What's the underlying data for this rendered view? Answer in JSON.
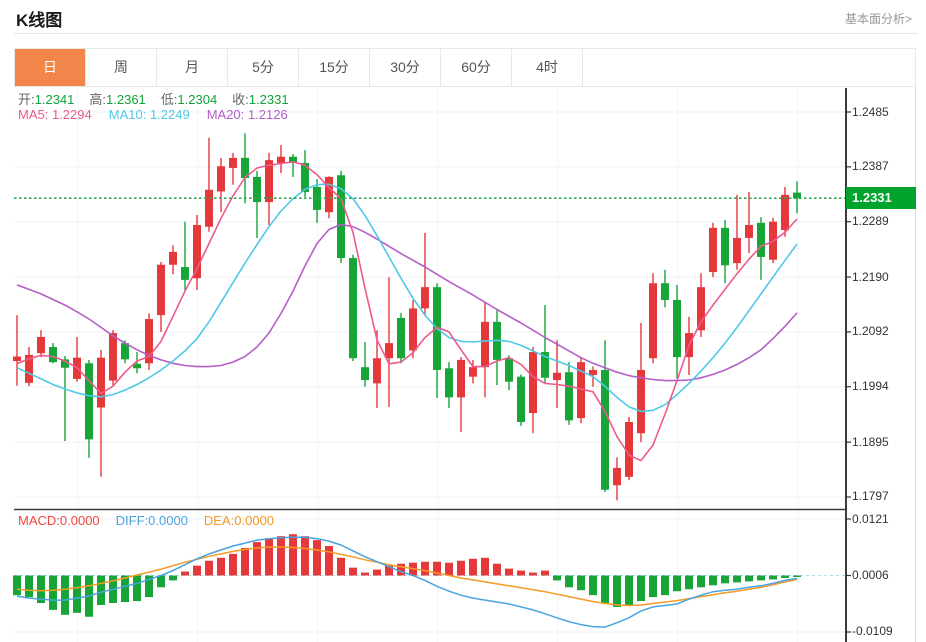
{
  "header": {
    "title": "K线图",
    "analysis_link": "基本面分析>"
  },
  "tabs": {
    "items": [
      {
        "name": "day",
        "label": "日",
        "active": true
      },
      {
        "name": "week",
        "label": "周",
        "active": false
      },
      {
        "name": "month",
        "label": "月",
        "active": false
      },
      {
        "name": "5min",
        "label": "5分",
        "active": false
      },
      {
        "name": "15min",
        "label": "15分",
        "active": false
      },
      {
        "name": "30min",
        "label": "30分",
        "active": false
      },
      {
        "name": "60min",
        "label": "60分",
        "active": false
      },
      {
        "name": "4hour",
        "label": "4时",
        "active": false
      }
    ]
  },
  "kline_legend": {
    "open_label": "开:",
    "open": "1.2341",
    "high_label": "高:",
    "high": "1.2361",
    "low_label": "低:",
    "low": "1.2304",
    "close_label": "收:",
    "close": "1.2331",
    "ma5_label": "MA5:",
    "ma5": "1.2294",
    "ma10_label": "MA10:",
    "ma10": "1.2249",
    "ma20_label": "MA20:",
    "ma20": "1.2126"
  },
  "macd_legend": {
    "macd_label": "MACD:",
    "macd": "0.0000",
    "diff_label": "DIFF:",
    "diff": "0.0000",
    "dea_label": "DEA:",
    "dea": "0.0000"
  },
  "price_axis": {
    "labels": [
      "1.2485",
      "1.2387",
      "1.2289",
      "1.2190",
      "1.2092",
      "1.1994",
      "1.1895",
      "1.1797"
    ],
    "current_price": "1.2331"
  },
  "macd_axis": {
    "labels": [
      "0.0121",
      "0.0006",
      "-0.0109"
    ]
  },
  "colors": {
    "accent_orange": "#f1854a",
    "up_red": "#e5383b",
    "down_green": "#17a538",
    "badge_green": "#00a32c",
    "price_line_green": "#2faa4e",
    "value_green": "#11a23a",
    "ma5_pink": "#ee5a8c",
    "ma10_cyan": "#4ec9e6",
    "ma20_purple": "#b55ec8",
    "macd_red": "#f0453c",
    "diff_blue": "#4aa3e0",
    "dea_orange": "#f59a23",
    "grid": "#edf1f7",
    "axis_dark": "#3a3a3a",
    "macd_zero_dash": "#b5d9e8"
  },
  "chart_data": {
    "type": "candlestick+macd",
    "title": "K线图 (日)",
    "y_range": [
      1.1797,
      1.2485
    ],
    "macd_y_range": [
      -0.0109,
      0.0121
    ],
    "grid": true,
    "candles_ohlc": [
      [
        1.204,
        1.2122,
        1.1996,
        1.2048
      ],
      [
        1.2001,
        1.2065,
        1.1995,
        1.2051
      ],
      [
        1.2054,
        1.2095,
        1.2047,
        1.2083
      ],
      [
        1.2065,
        1.2072,
        1.2036,
        1.2038
      ],
      [
        1.2043,
        1.2049,
        1.1897,
        1.2028
      ],
      [
        1.2008,
        1.2083,
        1.2003,
        1.2046
      ],
      [
        1.2036,
        1.2042,
        1.1867,
        1.19
      ],
      [
        1.1957,
        1.206,
        1.1833,
        1.2046
      ],
      [
        1.2005,
        1.2095,
        1.1997,
        1.209
      ],
      [
        1.2072,
        1.2077,
        1.2036,
        1.2043
      ],
      [
        1.2035,
        1.2056,
        1.2018,
        1.2027
      ],
      [
        1.2036,
        1.2125,
        1.2024,
        1.2115
      ],
      [
        1.2122,
        1.2217,
        1.2092,
        1.2212
      ],
      [
        1.2212,
        1.2247,
        1.2195,
        1.2235
      ],
      [
        1.2208,
        1.2289,
        1.2167,
        1.2185
      ],
      [
        1.2188,
        1.2301,
        1.2167,
        1.2283
      ],
      [
        1.228,
        1.2439,
        1.2271,
        1.2346
      ],
      [
        1.2343,
        1.2403,
        1.2306,
        1.2388
      ],
      [
        1.2385,
        1.2412,
        1.2355,
        1.2403
      ],
      [
        1.2403,
        1.2447,
        1.2322,
        1.2367
      ],
      [
        1.2369,
        1.238,
        1.226,
        1.2324
      ],
      [
        1.2324,
        1.2412,
        1.2283,
        1.2399
      ],
      [
        1.2394,
        1.2426,
        1.2376,
        1.2405
      ],
      [
        1.2405,
        1.241,
        1.2369,
        1.2394
      ],
      [
        1.2394,
        1.2417,
        1.2333,
        1.2342
      ],
      [
        1.2351,
        1.2365,
        1.2287,
        1.231
      ],
      [
        1.2306,
        1.237,
        1.2295,
        1.2369
      ],
      [
        1.2372,
        1.238,
        1.2215,
        1.2224
      ],
      [
        1.2224,
        1.223,
        1.204,
        1.2045
      ],
      [
        1.2029,
        1.2074,
        1.1994,
        1.2006
      ],
      [
        1.2,
        1.2095,
        1.1956,
        1.2045
      ],
      [
        1.2045,
        1.219,
        1.1958,
        1.2072
      ],
      [
        1.2117,
        1.2126,
        1.2036,
        1.2045
      ],
      [
        1.2059,
        1.2149,
        1.2045,
        1.2134
      ],
      [
        1.2134,
        1.2269,
        1.212,
        1.2172
      ],
      [
        1.2172,
        1.2179,
        1.1974,
        1.2024
      ],
      [
        1.2027,
        1.2038,
        1.1956,
        1.1975
      ],
      [
        1.1975,
        1.2047,
        1.1913,
        1.2042
      ],
      [
        1.2012,
        1.2042,
        1.2,
        1.2029
      ],
      [
        1.2029,
        1.2146,
        1.1975,
        1.211
      ],
      [
        1.211,
        1.2131,
        1.1997,
        1.2042
      ],
      [
        1.2045,
        1.205,
        1.1988,
        1.2003
      ],
      [
        1.2012,
        1.2016,
        1.1924,
        1.1931
      ],
      [
        1.1947,
        1.2065,
        1.1911,
        1.2056
      ],
      [
        1.2056,
        1.214,
        1.2,
        1.201
      ],
      [
        1.2006,
        1.2077,
        1.1956,
        1.2019
      ],
      [
        1.202,
        1.2038,
        1.1926,
        1.1934
      ],
      [
        1.1938,
        1.2047,
        1.1929,
        1.2038
      ],
      [
        1.2015,
        1.203,
        1.1994,
        1.2024
      ],
      [
        1.2024,
        1.2077,
        1.1806,
        1.181
      ],
      [
        1.1818,
        1.1868,
        1.1791,
        1.1849
      ],
      [
        1.1833,
        1.194,
        1.1827,
        1.1931
      ],
      [
        1.1911,
        1.2108,
        1.1895,
        1.2024
      ],
      [
        1.2045,
        1.2197,
        1.2036,
        1.2179
      ],
      [
        1.2179,
        1.2203,
        1.2136,
        1.2149
      ],
      [
        1.2149,
        1.2176,
        1.2009,
        1.2047
      ],
      [
        1.2047,
        1.2119,
        1.2015,
        1.209
      ],
      [
        1.2095,
        1.2197,
        1.2083,
        1.2172
      ],
      [
        1.2199,
        1.2287,
        1.219,
        1.2278
      ],
      [
        1.2278,
        1.2292,
        1.2179,
        1.2211
      ],
      [
        1.2215,
        1.2337,
        1.2203,
        1.226
      ],
      [
        1.226,
        1.2342,
        1.2233,
        1.2283
      ],
      [
        1.2287,
        1.2297,
        1.2185,
        1.2226
      ],
      [
        1.2221,
        1.2296,
        1.2215,
        1.2289
      ],
      [
        1.2274,
        1.2351,
        1.2262,
        1.2337
      ],
      [
        1.2341,
        1.2361,
        1.2304,
        1.2331
      ]
    ],
    "ma5": [
      1.2035,
      1.2044,
      1.205,
      1.2048,
      1.204,
      1.2028,
      1.2005,
      1.1982,
      1.1995,
      1.202,
      1.204,
      1.2048,
      1.2075,
      1.212,
      1.2165,
      1.2205,
      1.225,
      1.2295,
      1.2335,
      1.2368,
      1.2385,
      1.239,
      1.2393,
      1.2396,
      1.239,
      1.2373,
      1.235,
      1.233,
      1.227,
      1.217,
      1.2078,
      1.2035,
      1.2038,
      1.2055,
      1.2082,
      1.21,
      1.2092,
      1.206,
      1.203,
      1.203,
      1.204,
      1.2046,
      1.2034,
      1.2012,
      1.2,
      1.1998,
      1.1995,
      1.199,
      1.1985,
      1.195,
      1.1905,
      1.1872,
      1.1862,
      1.189,
      1.1945,
      1.2005,
      1.2068,
      1.211,
      1.214,
      1.2168,
      1.2196,
      1.2222,
      1.2245,
      1.2254,
      1.227,
      1.2294
    ],
    "ma10": [
      1.2028,
      1.2018,
      1.2008,
      1.1998,
      1.199,
      1.1983,
      1.1978,
      1.1976,
      1.198,
      1.1988,
      1.1998,
      1.201,
      1.2024,
      1.204,
      1.2058,
      1.208,
      1.211,
      1.2145,
      1.218,
      1.2215,
      1.2248,
      1.228,
      1.2308,
      1.233,
      1.2347,
      1.2355,
      1.2356,
      1.2348,
      1.233,
      1.23,
      1.2264,
      1.2226,
      1.2188,
      1.2152,
      1.2122,
      1.2098,
      1.2082,
      1.2075,
      1.2074,
      1.2076,
      1.2077,
      1.2075,
      1.2068,
      1.2058,
      1.2048,
      1.204,
      1.2032,
      1.2022,
      1.2012,
      1.1995,
      1.1975,
      1.1958,
      1.195,
      1.1952,
      1.1962,
      1.198,
      1.2,
      1.2022,
      1.2046,
      1.2072,
      1.21,
      1.213,
      1.216,
      1.219,
      1.222,
      1.2249
    ],
    "ma20": [
      1.2176,
      1.2168,
      1.216,
      1.215,
      1.214,
      1.2128,
      1.2115,
      1.21,
      1.2085,
      1.2072,
      1.206,
      1.205,
      1.2042,
      1.2036,
      1.2032,
      1.203,
      1.203,
      1.2032,
      1.2038,
      1.2048,
      1.2065,
      1.209,
      1.2125,
      1.2165,
      1.221,
      1.225,
      1.2275,
      1.2284,
      1.228,
      1.227,
      1.2258,
      1.2245,
      1.2232,
      1.222,
      1.2208,
      1.2195,
      1.2182,
      1.217,
      1.2158,
      1.2145,
      1.2132,
      1.212,
      1.2108,
      1.2095,
      1.2082,
      1.207,
      1.2058,
      1.2046,
      1.2036,
      1.2028,
      1.202,
      1.2014,
      1.201,
      1.2007,
      1.2005,
      1.2005,
      1.2006,
      1.201,
      1.2016,
      1.2024,
      1.2034,
      1.2046,
      1.206,
      1.208,
      1.2102,
      1.2126
    ],
    "macd": {
      "baseline_value": 0.0006,
      "histogram": [
        -0.004,
        -0.0044,
        -0.0056,
        -0.007,
        -0.008,
        -0.0076,
        -0.0084,
        -0.006,
        -0.0056,
        -0.0054,
        -0.0052,
        -0.0044,
        -0.0024,
        -0.001,
        0.0008,
        0.002,
        0.003,
        0.0036,
        0.0044,
        0.0056,
        0.0068,
        0.0076,
        0.008,
        0.0084,
        0.008,
        0.0072,
        0.006,
        0.0036,
        0.0016,
        0.0006,
        0.0012,
        0.002,
        0.0024,
        0.0026,
        0.0028,
        0.0028,
        0.0026,
        0.003,
        0.0034,
        0.0036,
        0.0024,
        0.0014,
        0.001,
        0.0006,
        0.001,
        -0.001,
        -0.0024,
        -0.003,
        -0.004,
        -0.0056,
        -0.0064,
        -0.006,
        -0.0052,
        -0.0044,
        -0.004,
        -0.0032,
        -0.0028,
        -0.0024,
        -0.002,
        -0.0016,
        -0.0014,
        -0.0012,
        -0.001,
        -0.0008,
        -0.0005,
        -0.0003
      ],
      "diff": [
        -0.0042,
        -0.0046,
        -0.0048,
        -0.005,
        -0.005,
        -0.0046,
        -0.0042,
        -0.0034,
        -0.0028,
        -0.0022,
        -0.0016,
        -0.0008,
        0.0,
        0.001,
        0.0022,
        0.0034,
        0.0044,
        0.0052,
        0.006,
        0.0066,
        0.0072,
        0.0075,
        0.0077,
        0.0078,
        0.0078,
        0.0075,
        0.007,
        0.0062,
        0.005,
        0.0038,
        0.0028,
        0.0018,
        0.0008,
        0.0,
        -0.001,
        -0.0022,
        -0.0032,
        -0.004,
        -0.0046,
        -0.005,
        -0.0054,
        -0.0058,
        -0.0064,
        -0.007,
        -0.0078,
        -0.0086,
        -0.0094,
        -0.01,
        -0.0104,
        -0.0105,
        -0.0096,
        -0.0086,
        -0.0072,
        -0.0064,
        -0.0061,
        -0.0058,
        -0.0048,
        -0.004,
        -0.0033,
        -0.003,
        -0.0028,
        -0.0024,
        -0.0021,
        -0.0016,
        -0.001,
        -0.0006
      ],
      "dea": [
        -0.0028,
        -0.003,
        -0.0031,
        -0.003,
        -0.0028,
        -0.0025,
        -0.0021,
        -0.0016,
        -0.0011,
        -0.0005,
        0.0001,
        0.0007,
        0.0013,
        0.002,
        0.0027,
        0.0033,
        0.0039,
        0.0044,
        0.0049,
        0.0053,
        0.0056,
        0.0058,
        0.0058,
        0.0057,
        0.0055,
        0.0052,
        0.0048,
        0.0043,
        0.0038,
        0.0032,
        0.0027,
        0.0022,
        0.0018,
        0.0014,
        0.001,
        0.0005,
        0.0,
        -0.0005,
        -0.0009,
        -0.0013,
        -0.0017,
        -0.0021,
        -0.0025,
        -0.0029,
        -0.0033,
        -0.0038,
        -0.0043,
        -0.0048,
        -0.0053,
        -0.0057,
        -0.006,
        -0.0061,
        -0.006,
        -0.0057,
        -0.0054,
        -0.0051,
        -0.0047,
        -0.0043,
        -0.0039,
        -0.0035,
        -0.0032,
        -0.0028,
        -0.0024,
        -0.0019,
        -0.0013,
        -0.0008
      ]
    }
  }
}
